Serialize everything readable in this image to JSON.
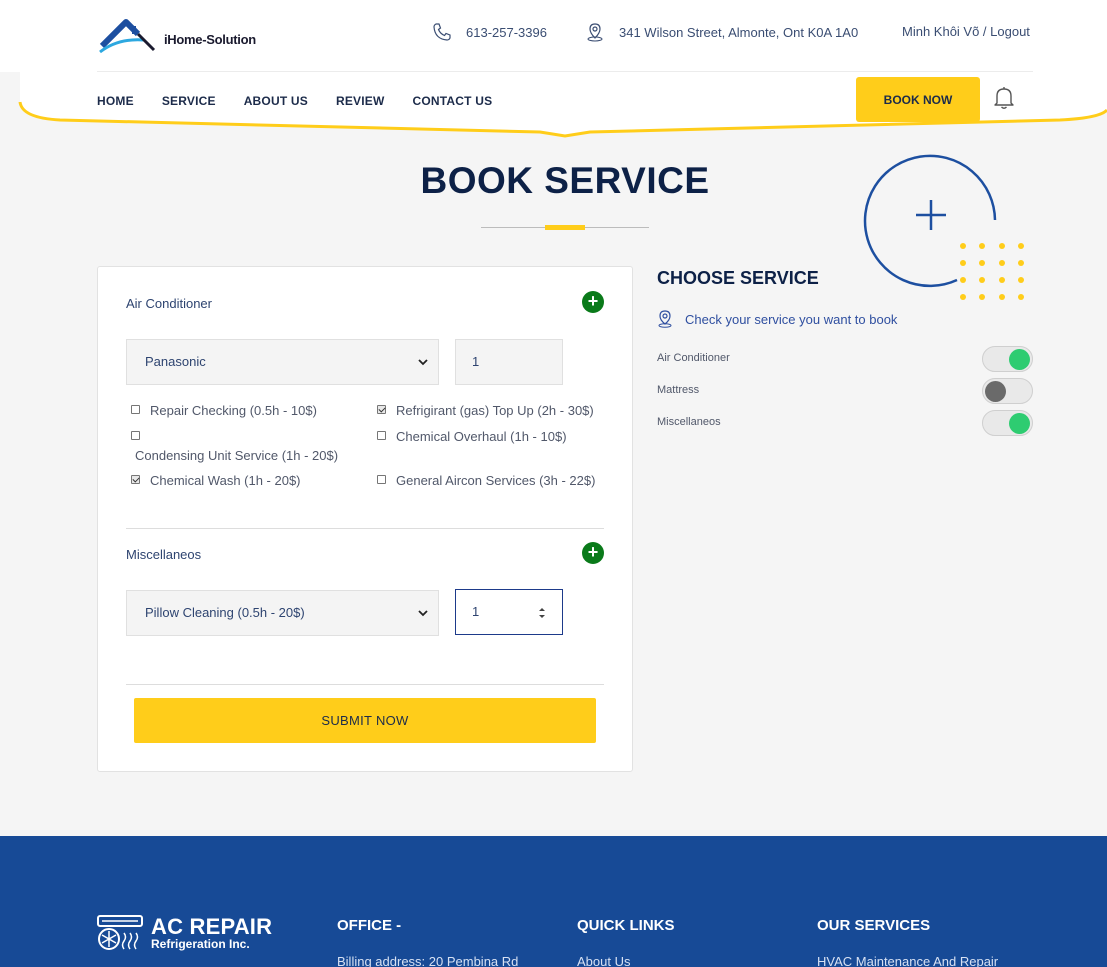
{
  "header": {
    "logo_text": "iHome-Solution",
    "phone": "613-257-3396",
    "address": "341 Wilson Street, Almonte, Ont K0A 1A0",
    "user": "Minh Khôi Võ / Logout"
  },
  "nav": {
    "items": [
      "HOME",
      "SERVICE",
      "ABOUT US",
      "REVIEW",
      "CONTACT US"
    ],
    "book_now": "BOOK NOW"
  },
  "page": {
    "title": "BOOK SERVICE"
  },
  "form": {
    "section1": {
      "label": "Air Conditioner",
      "brand_selected": "Panasonic",
      "quantity": "1",
      "options": [
        {
          "label": "Repair Checking (0.5h - 10$)",
          "checked": false
        },
        {
          "label": "Refrigirant (gas) Top Up (2h - 30$)",
          "checked": true
        },
        {
          "label": "Condensing Unit Service (1h - 20$)",
          "checked": false
        },
        {
          "label": "Chemical Overhaul (1h - 10$)",
          "checked": false
        },
        {
          "label": "Chemical Wash (1h - 20$)",
          "checked": true
        },
        {
          "label": "General Aircon Services (3h - 22$)",
          "checked": false
        }
      ]
    },
    "section2": {
      "label": "Miscellaneos",
      "service_selected": "Pillow Cleaning (0.5h - 20$)",
      "quantity": "1"
    },
    "submit_label": "SUBMIT NOW"
  },
  "choose_service": {
    "title": "CHOOSE SERVICE",
    "subtitle": "Check your service you want to book",
    "toggles": [
      {
        "label": "Air Conditioner",
        "on": true
      },
      {
        "label": "Mattress",
        "on": false
      },
      {
        "label": "Miscellaneos",
        "on": true
      }
    ]
  },
  "footer": {
    "brand_title": "AC REPAIR",
    "brand_sub": "Refrigeration Inc.",
    "office_head": "OFFICE -",
    "office_text": "Billing address: 20 Pembina Rd",
    "links_head": "QUICK LINKS",
    "links_first": "About Us",
    "services_head": "OUR SERVICES",
    "services_first": "HVAC Maintenance And Repair"
  },
  "colors": {
    "accent_yellow": "#ffcd1a",
    "navy": "#0d2147",
    "footer_blue": "#174a96",
    "toggle_on": "#2ecc71",
    "plus_green": "#0a7a1a"
  }
}
